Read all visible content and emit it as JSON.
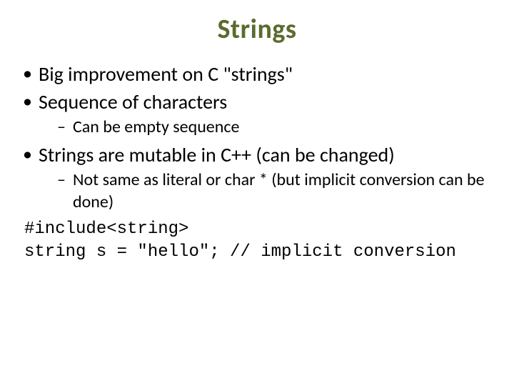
{
  "title": "Strings",
  "bullets": {
    "b1": "Big improvement on C \"strings\"",
    "b2": "Sequence of characters",
    "b2_1": "Can be empty sequence",
    "b3": "Strings are mutable in C++ (can be changed)",
    "b3_1": "Not same as literal or char * (but implicit conversion can be done)"
  },
  "code": {
    "line1": "#include<string>",
    "line2": "string s = \"hello\"; // implicit conversion"
  }
}
